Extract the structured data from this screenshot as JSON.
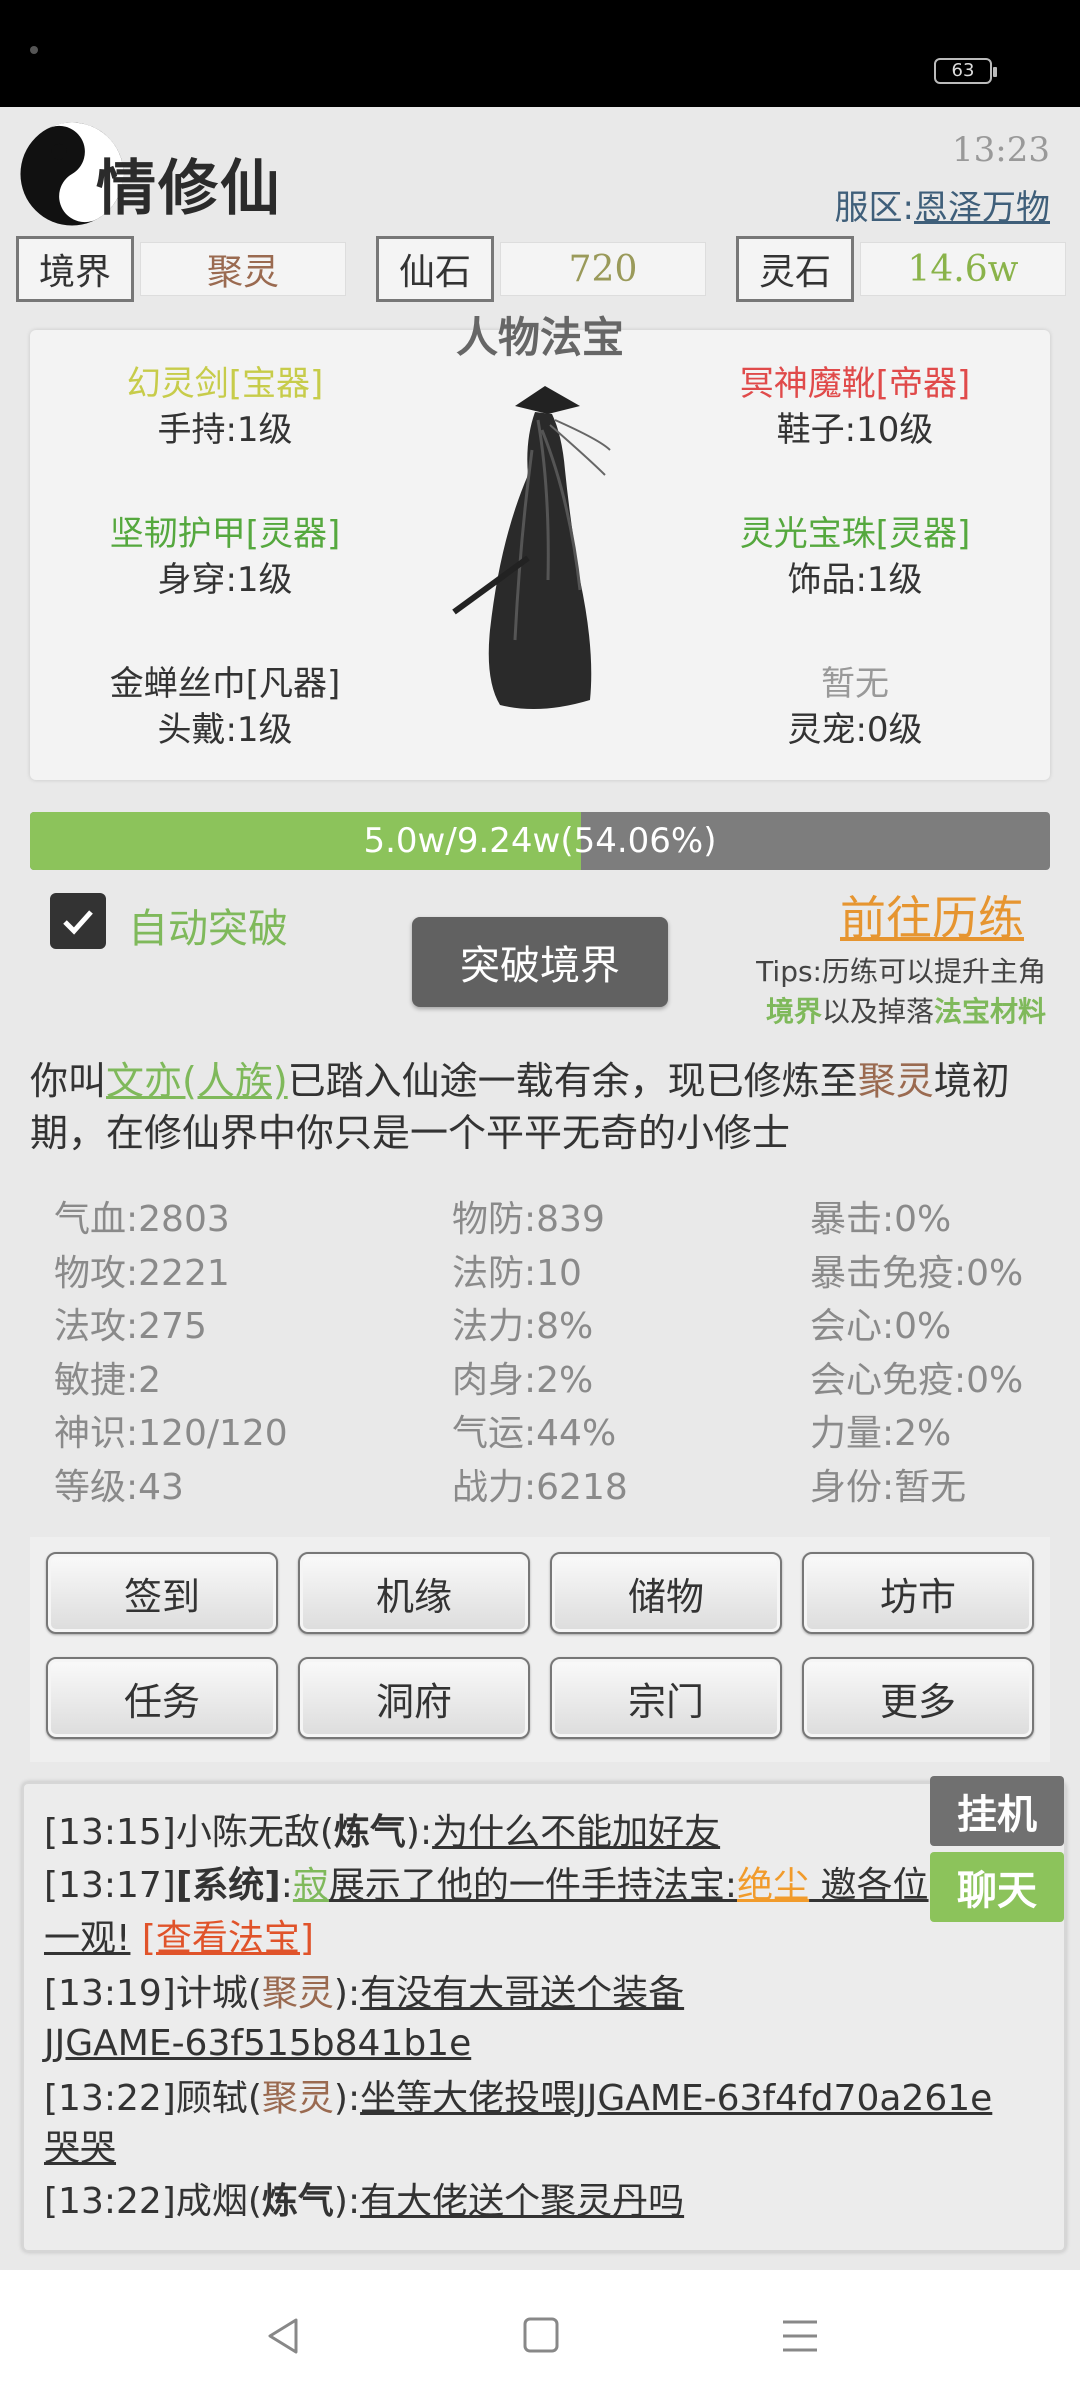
{
  "status_bar": {
    "battery": "63"
  },
  "header": {
    "title": "情修仙",
    "clock": "13:23",
    "server_label": "服区:",
    "server_name": "恩泽万物"
  },
  "stats": [
    {
      "label": "境界",
      "value": "聚灵",
      "color": "#9a6a50"
    },
    {
      "label": "仙石",
      "value": "720",
      "color": "#9a9a5a"
    },
    {
      "label": "灵石",
      "value": "14.6w",
      "color": "#8ab34a"
    }
  ],
  "equipment": {
    "title": "人物法宝",
    "items": [
      {
        "name": "幻灵剑[宝器]",
        "slot": "手持:1级",
        "color": "#c7cc4a"
      },
      {
        "name": "冥神魔靴[帝器]",
        "slot": "鞋子:10级",
        "color": "#e04a4a"
      },
      {
        "name": "坚韧护甲[灵器]",
        "slot": "身穿:1级",
        "color": "#55a83e"
      },
      {
        "name": "灵光宝珠[灵器]",
        "slot": "饰品:1级",
        "color": "#55a83e"
      },
      {
        "name": "金蝉丝巾[凡器]",
        "slot": "头戴:1级",
        "color": "#333333"
      },
      {
        "name": "暂无",
        "slot": "灵宠:0级",
        "color": "#999999"
      }
    ]
  },
  "progress": {
    "text": "5.0w/9.24w(54.06%)",
    "fraction": 0.5406
  },
  "auto_break": {
    "label": "自动突破",
    "checked": true
  },
  "breakthrough_button": "突破境界",
  "goto_training": "前往历练",
  "tips": {
    "line1": "Tips:历练可以提升主角",
    "realm_word": "境界",
    "mid": "以及掉落",
    "material_word": "法宝材料"
  },
  "intro": {
    "p1": "你叫",
    "name": "文亦(人族)",
    "p2": "已踏入仙途一载有余，现已修炼至",
    "realm": "聚灵",
    "p3": "境初期，在修仙界中你只是一个平平无奇的小修士"
  },
  "attributes": [
    [
      "气血:2803",
      "物防:839",
      "暴击:0%"
    ],
    [
      "物攻:2221",
      "法防:10",
      "暴击免疫:0%"
    ],
    [
      "法攻:275",
      "法力:8%",
      "会心:0%"
    ],
    [
      "敏捷:2",
      "肉身:2%",
      "会心免疫:0%"
    ],
    [
      "神识:120/120",
      "气运:44%",
      "力量:2%"
    ],
    [
      "等级:43",
      "战力:6218",
      "身份:暂无"
    ]
  ],
  "buttons": [
    "签到",
    "机缘",
    "储物",
    "坊市",
    "任务",
    "洞府",
    "宗门",
    "更多"
  ],
  "chat": {
    "tab_idle": "挂机",
    "tab_chat": "聊天",
    "lines": {
      "l1_time": "[13:15]",
      "l1_user": "小陈无敌(",
      "l1_realm": "炼气",
      "l1_close": "):",
      "l1_msg": "为什么不能加好友",
      "l2_time": "[13:17]",
      "l2_sys": "[系统]",
      "l2_colon": ":",
      "l2_user": "寂",
      "l2_msg": "展示了他的一件手持法宝:",
      "l2_item": "绝尘",
      "l2_tail": " 邀各位",
      "l2b_msg": "一观!",
      "l2b_link": "[查看法宝]",
      "l3_time": "[13:19]",
      "l3_user": "计城(",
      "l3_realm": "聚灵",
      "l3_close": "):",
      "l3_msg": "有没有大哥送个装备",
      "l3b_msg": "JJGAME-63f515b841b1e",
      "l4_time": "[13:22]",
      "l4_user": "顾轼(",
      "l4_realm": "聚灵",
      "l4_close": "):",
      "l4_msg": "坐等大佬投喂JJGAME-63f4fd70a261e",
      "l4b_msg": "哭哭",
      "l5_time": "[13:22]",
      "l5_user": "成烟(",
      "l5_realm": "炼气",
      "l5_close": "):",
      "l5_msg": "有大佬送个聚灵丹吗"
    }
  },
  "colors": {
    "accent_green": "#8cc35b",
    "accent_orange": "#e69530",
    "realm_brown": "#9a6a50"
  }
}
